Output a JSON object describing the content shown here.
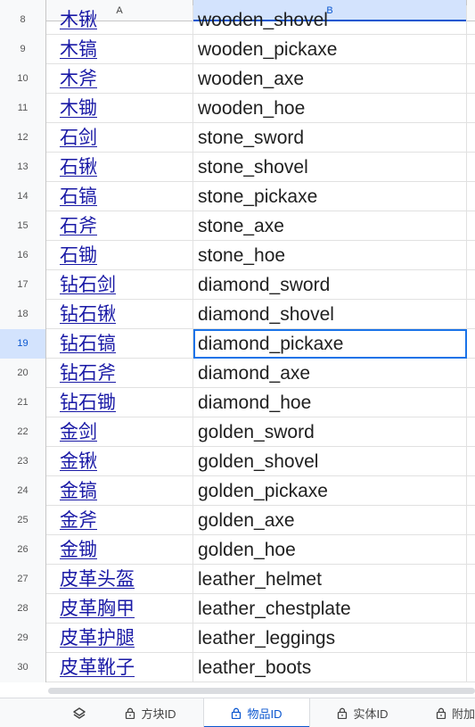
{
  "columns": [
    {
      "label": "A"
    },
    {
      "label": "B"
    }
  ],
  "selected_row": 19,
  "rows": [
    {
      "num": "8",
      "a": "木锹",
      "b": "wooden_shovel"
    },
    {
      "num": "9",
      "a": "木镐",
      "b": "wooden_pickaxe"
    },
    {
      "num": "10",
      "a": "木斧",
      "b": "wooden_axe"
    },
    {
      "num": "11",
      "a": "木锄",
      "b": "wooden_hoe"
    },
    {
      "num": "12",
      "a": "石剑",
      "b": "stone_sword"
    },
    {
      "num": "13",
      "a": "石锹",
      "b": "stone_shovel"
    },
    {
      "num": "14",
      "a": "石镐",
      "b": "stone_pickaxe"
    },
    {
      "num": "15",
      "a": "石斧",
      "b": "stone_axe"
    },
    {
      "num": "16",
      "a": "石锄",
      "b": "stone_hoe"
    },
    {
      "num": "17",
      "a": "钻石剑",
      "b": "diamond_sword"
    },
    {
      "num": "18",
      "a": "钻石锹",
      "b": "diamond_shovel"
    },
    {
      "num": "19",
      "a": "钻石镐",
      "b": "diamond_pickaxe"
    },
    {
      "num": "20",
      "a": "钻石斧",
      "b": "diamond_axe"
    },
    {
      "num": "21",
      "a": "钻石锄",
      "b": "diamond_hoe"
    },
    {
      "num": "22",
      "a": "金剑",
      "b": "golden_sword"
    },
    {
      "num": "23",
      "a": "金锹",
      "b": "golden_shovel"
    },
    {
      "num": "24",
      "a": "金镐",
      "b": "golden_pickaxe"
    },
    {
      "num": "25",
      "a": "金斧",
      "b": "golden_axe"
    },
    {
      "num": "26",
      "a": "金锄",
      "b": "golden_hoe"
    },
    {
      "num": "27",
      "a": "皮革头盔",
      "b": "leather_helmet"
    },
    {
      "num": "28",
      "a": "皮革胸甲",
      "b": "leather_chestplate"
    },
    {
      "num": "29",
      "a": "皮革护腿",
      "b": "leather_leggings"
    },
    {
      "num": "30",
      "a": "皮革靴子",
      "b": "leather_boots"
    }
  ],
  "tabs": [
    {
      "label": "方块ID",
      "icon": "lock-icon",
      "active": false
    },
    {
      "label": "物品ID",
      "icon": "lock-icon",
      "active": true
    },
    {
      "label": "实体ID",
      "icon": "lock-icon",
      "active": false
    },
    {
      "label": "附加",
      "icon": "lock-icon",
      "active": false
    }
  ],
  "all_sheets_icon": "layers-icon",
  "colors": {
    "link": "#1a1aa6",
    "selection": "#1a73e8",
    "header_bg": "#f8f9fa",
    "active_tab": "#0b57d0"
  }
}
